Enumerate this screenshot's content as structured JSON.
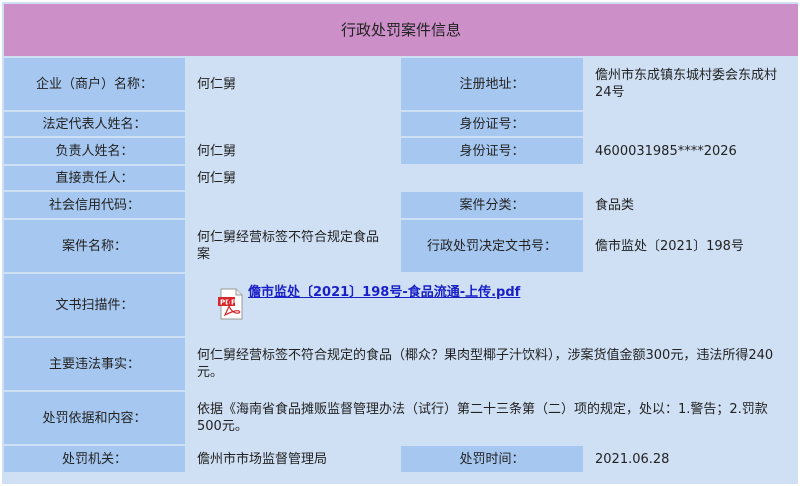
{
  "title": "行政处罚案件信息",
  "enterprise": {
    "label": "企业（商户）名称：",
    "value": "何仁舅"
  },
  "address": {
    "label": "注册地址：",
    "value": "儋州市东成镇东城村委会东成村24号"
  },
  "legal_rep": {
    "label": "法定代表人姓名：",
    "value": ""
  },
  "legal_id": {
    "label": "身份证号：",
    "value": ""
  },
  "responsible": {
    "label": "负责人姓名：",
    "value": "何仁舅"
  },
  "responsible_id": {
    "label": "身份证号：",
    "value": "4600031985****2026"
  },
  "direct": {
    "label": "直接责任人：",
    "value": "何仁舅"
  },
  "credit_code": {
    "label": "社会信用代码：",
    "value": ""
  },
  "category": {
    "label": "案件分类：",
    "value": "食品类"
  },
  "case_name": {
    "label": "案件名称：",
    "value": "何仁舅经营标签不符合规定食品案"
  },
  "decision_no": {
    "label": "行政处罚决定文书号：",
    "value": "儋市监处〔2021〕198号"
  },
  "document": {
    "label": "文书扫描件：",
    "file": "儋市监处〔2021〕198号-食品流通-上传.pdf",
    "icon": "pdf-file-icon"
  },
  "facts": {
    "label": "主要违法事实：",
    "value": "何仁舅经营标签不符合规定的食品（椰众？果肉型椰子汁饮料），涉案货值金额300元，违法所得240元。"
  },
  "basis": {
    "label": "处罚依据和内容：",
    "value": "依据《海南省食品摊贩监督管理办法（试行）第二十三条第（二）项的规定，处以：1.警告；2.罚款500元。"
  },
  "authority": {
    "label": "处罚机关：",
    "value": "儋州市市场监督管理局"
  },
  "date": {
    "label": "处罚时间：",
    "value": "2021.06.28"
  },
  "colors": {
    "title_bg": "#cc8fc8",
    "label_bg": "#a6c8f0",
    "value_bg": "#cfe0f4",
    "link": "#1a20c8"
  }
}
